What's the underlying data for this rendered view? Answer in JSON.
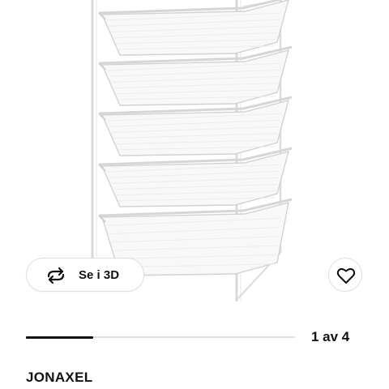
{
  "product": {
    "name": "JONAXEL",
    "image_alt": "JONAXEL"
  },
  "view3d": {
    "label": "Se i 3D",
    "icon": "rotate-3d-icon"
  },
  "favourite": {
    "icon": "heart-icon"
  },
  "gallery": {
    "current": 1,
    "total": 4,
    "pager_text": "1 av 4",
    "progress_fraction": 0.25
  }
}
